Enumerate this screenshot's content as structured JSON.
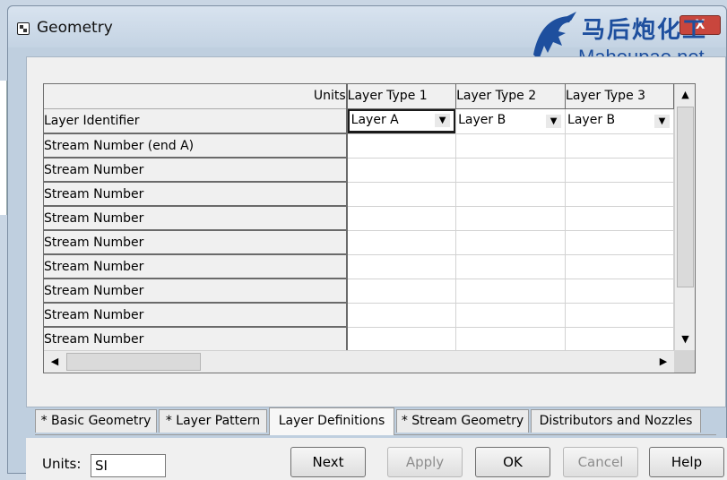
{
  "window": {
    "title": "Geometry",
    "close_label": "X"
  },
  "watermark": {
    "logo_cn": "马后炮化工",
    "logo_en": "Mahoupao.net"
  },
  "grid": {
    "units_header": "Units",
    "columns": [
      "Layer Type 1",
      "Layer Type 2",
      "Layer Type 3"
    ],
    "layer_identifier": {
      "label": "Layer Identifier",
      "values": [
        "Layer A",
        "Layer B",
        "Layer B"
      ]
    },
    "rows": [
      "Stream Number (end A)",
      "Stream Number",
      "Stream Number",
      "Stream Number",
      "Stream Number",
      "Stream Number",
      "Stream Number",
      "Stream Number",
      "Stream Number"
    ]
  },
  "tabs": [
    "* Basic Geometry",
    "* Layer Pattern",
    "Layer Definitions",
    "* Stream Geometry",
    "Distributors and Nozzles"
  ],
  "selected_tab": "Layer Definitions",
  "footer": {
    "units_label": "Units:",
    "units_value": "SI",
    "next": "Next",
    "apply": "Apply",
    "ok": "OK",
    "cancel": "Cancel",
    "help": "Help"
  }
}
